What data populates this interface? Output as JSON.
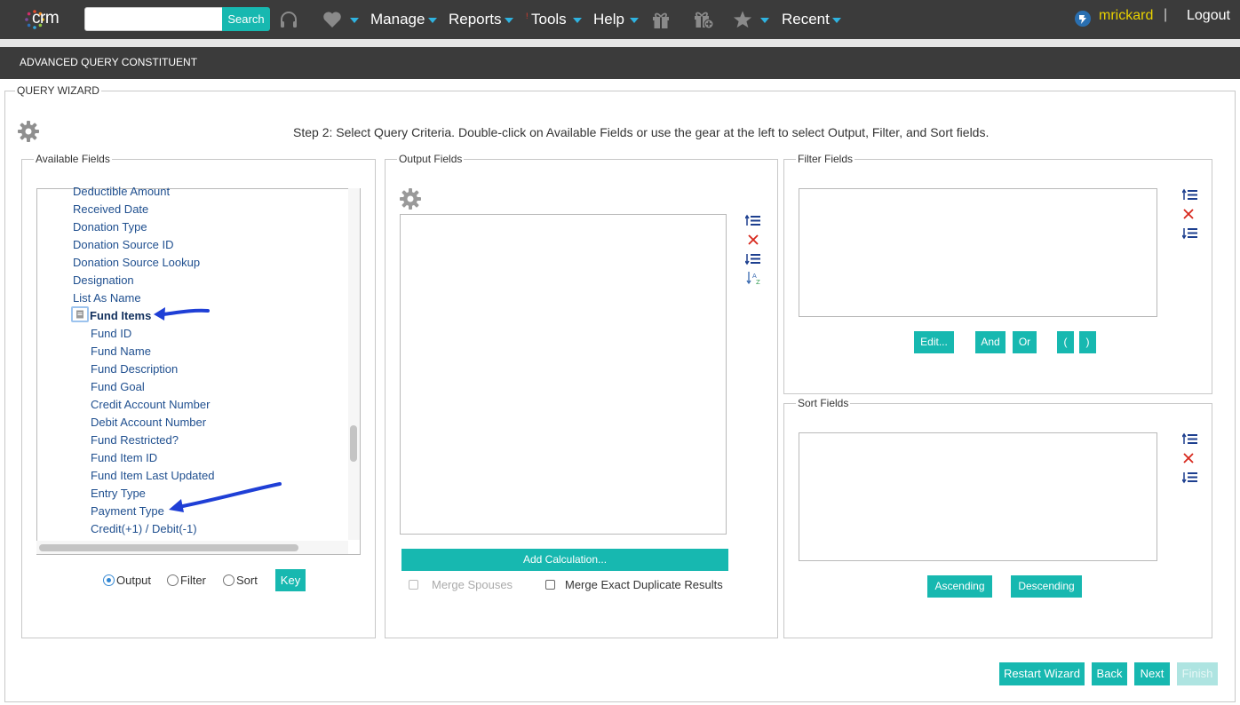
{
  "nav": {
    "logo_text": "crm",
    "search_placeholder": "",
    "search_button": "Search",
    "menu": [
      "Manage",
      "Reports",
      "Tools",
      "Help"
    ],
    "recent": "Recent",
    "username": "mrickard",
    "separator": "|",
    "logout": "Logout",
    "accent_color": "#17b8b0"
  },
  "page_title": "ADVANCED QUERY CONSTITUENT",
  "wizard": {
    "legend": "QUERY WIZARD",
    "step_text": "Step 2: Select Query Criteria. Double-click on Available Fields or use the gear at the left to select Output, Filter, and Sort fields."
  },
  "available": {
    "legend": "Available Fields",
    "items": [
      "Deductible Amount",
      "Received Date",
      "Donation Type",
      "Donation Source ID",
      "Donation Source Lookup",
      "Designation",
      "List As Name",
      "Fund Items",
      "Fund ID",
      "Fund Name",
      "Fund Description",
      "Fund Goal",
      "Credit Account Number",
      "Debit Account Number",
      "Fund Restricted?",
      "Fund Item ID",
      "Fund Item Last Updated",
      "Entry Type",
      "Payment Type",
      "Credit(+1) / Debit(-1)"
    ],
    "radio": [
      "Output",
      "Filter",
      "Sort"
    ],
    "radio_selected": "Output",
    "key_button": "Key"
  },
  "output": {
    "legend": "Output Fields",
    "add_calc": "Add Calculation...",
    "merge_spouses": "Merge Spouses",
    "merge_duplicates": "Merge Exact Duplicate Results"
  },
  "filter": {
    "legend": "Filter Fields",
    "buttons": [
      "Edit...",
      "And",
      "Or",
      "(",
      ")"
    ]
  },
  "sort": {
    "legend": "Sort Fields",
    "buttons": [
      "Ascending",
      "Descending"
    ]
  },
  "footer": {
    "buttons": [
      "Restart Wizard",
      "Back",
      "Next",
      "Finish"
    ]
  }
}
